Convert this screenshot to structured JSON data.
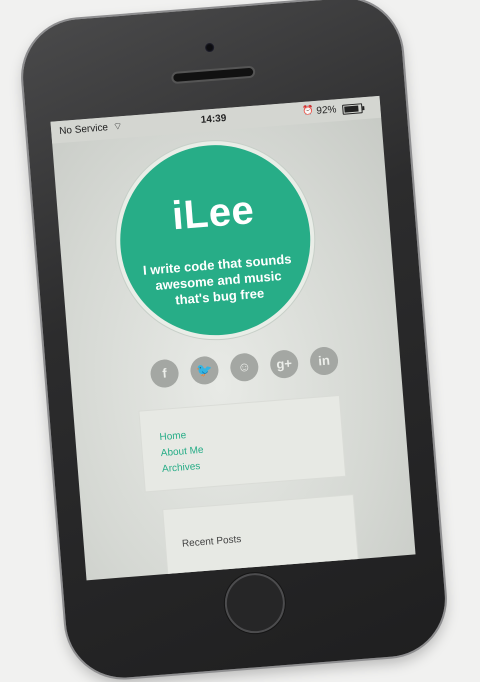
{
  "status_bar": {
    "carrier": "No Service",
    "time": "14:39",
    "battery": "92%"
  },
  "hero": {
    "title": "iLee",
    "tagline": "I write code that sounds awesome and music that's bug free",
    "color": "#27ad87"
  },
  "social": [
    {
      "name": "facebook-icon",
      "glyph": "f"
    },
    {
      "name": "twitter-icon",
      "glyph": "🐦"
    },
    {
      "name": "github-icon",
      "glyph": "☺"
    },
    {
      "name": "google-plus-icon",
      "glyph": "g+"
    },
    {
      "name": "linkedin-icon",
      "glyph": "in"
    }
  ],
  "nav": {
    "items": [
      "Home",
      "About Me",
      "Archives"
    ]
  },
  "recent": {
    "title": "Recent Posts"
  }
}
